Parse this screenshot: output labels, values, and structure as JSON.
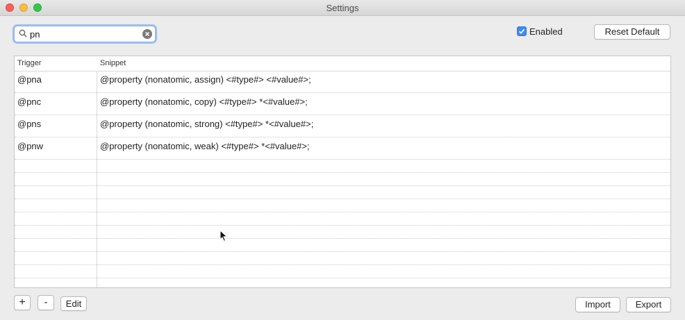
{
  "window": {
    "title": "Settings"
  },
  "search": {
    "value": "pn",
    "icon": "search-icon"
  },
  "enabled": {
    "label": "Enabled",
    "checked": true
  },
  "toolbar": {
    "reset_label": "Reset Default"
  },
  "table": {
    "columns": [
      "Trigger",
      "Snippet"
    ],
    "rows": [
      {
        "trigger": "@pna",
        "snippet": "@property (nonatomic, assign) <#type#> <#value#>;"
      },
      {
        "trigger": "@pnc",
        "snippet": "@property (nonatomic, copy) <#type#> *<#value#>;"
      },
      {
        "trigger": "@pns",
        "snippet": "@property (nonatomic, strong) <#type#> *<#value#>;"
      },
      {
        "trigger": "@pnw",
        "snippet": "@property (nonatomic, weak) <#type#> *<#value#>;"
      }
    ]
  },
  "bottom": {
    "add_label": "+",
    "remove_label": "-",
    "edit_label": "Edit",
    "import_label": "Import",
    "export_label": "Export"
  },
  "colors": {
    "accent": "#3d8af7",
    "focus_ring": "#9dc0f3"
  }
}
